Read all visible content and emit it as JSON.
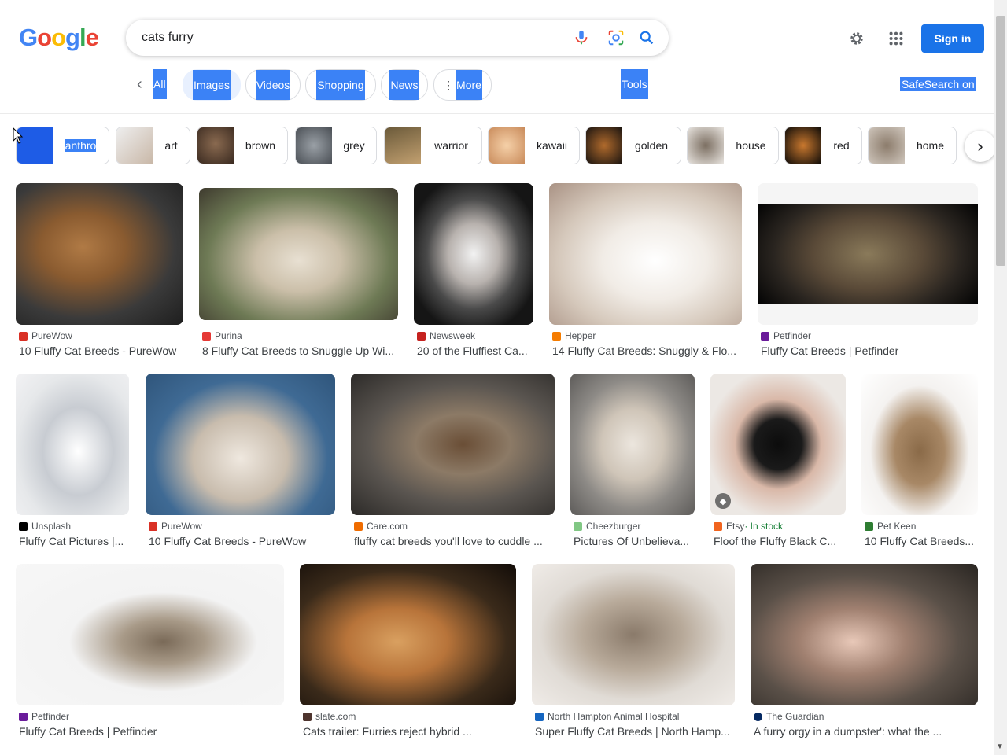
{
  "search": {
    "query": "cats furry"
  },
  "header": {
    "signin": "Sign in",
    "logo": "Google"
  },
  "tabs": {
    "all": "All",
    "images": "Images",
    "videos": "Videos",
    "shopping": "Shopping",
    "news": "News",
    "more": "More",
    "tools": "Tools",
    "safesearch": "SafeSearch on"
  },
  "chips": [
    "anthro",
    "art",
    "brown",
    "grey",
    "warrior",
    "kawaii",
    "golden",
    "house",
    "red",
    "home"
  ],
  "results": [
    {
      "source": "PureWow",
      "title": "10 Fluffy Cat Breeds - PureWow",
      "color": "#d93025"
    },
    {
      "source": "Purina",
      "title": "8 Fluffy Cat Breeds to Snuggle Up Wi...",
      "color": "#e53935"
    },
    {
      "source": "Newsweek",
      "title": "20 of the Fluffiest Ca...",
      "color": "#c5221f"
    },
    {
      "source": "Hepper",
      "title": "14 Fluffy Cat Breeds: Snuggly & Flo...",
      "color": "#f57c00"
    },
    {
      "source": "Petfinder",
      "title": "Fluffy Cat Breeds | Petfinder",
      "color": "#6a1b9a"
    },
    {
      "source": "Unsplash",
      "title": "Fluffy Cat Pictures |...",
      "color": "#000000"
    },
    {
      "source": "PureWow",
      "title": "10 Fluffy Cat Breeds - PureWow",
      "color": "#d93025"
    },
    {
      "source": "Care.com",
      "title": "fluffy cat breeds you'll love to cuddle ...",
      "color": "#ef6c00"
    },
    {
      "source": "Cheezburger",
      "title": "Pictures Of Unbelieva...",
      "color": "#81c784"
    },
    {
      "source": "Etsy",
      "source_extra": " · In stock",
      "title": "Floof the Fluffy Black C...",
      "color": "#f1641e"
    },
    {
      "source": "Pet Keen",
      "title": "10 Fluffy Cat Breeds...",
      "color": "#2e7d32"
    },
    {
      "source": "Petfinder",
      "title": "Fluffy Cat Breeds | Petfinder",
      "color": "#6a1b9a"
    },
    {
      "source": "slate.com",
      "title": "Cats trailer: Furries reject hybrid ...",
      "color": "#4e342e"
    },
    {
      "source": "North Hampton Animal Hospital",
      "title": "Super Fluffy Cat Breeds | North Hamp...",
      "color": "#1565c0"
    },
    {
      "source": "The Guardian",
      "title": "A furry orgy in a dumpster': what the ...",
      "color": "#052962"
    }
  ]
}
